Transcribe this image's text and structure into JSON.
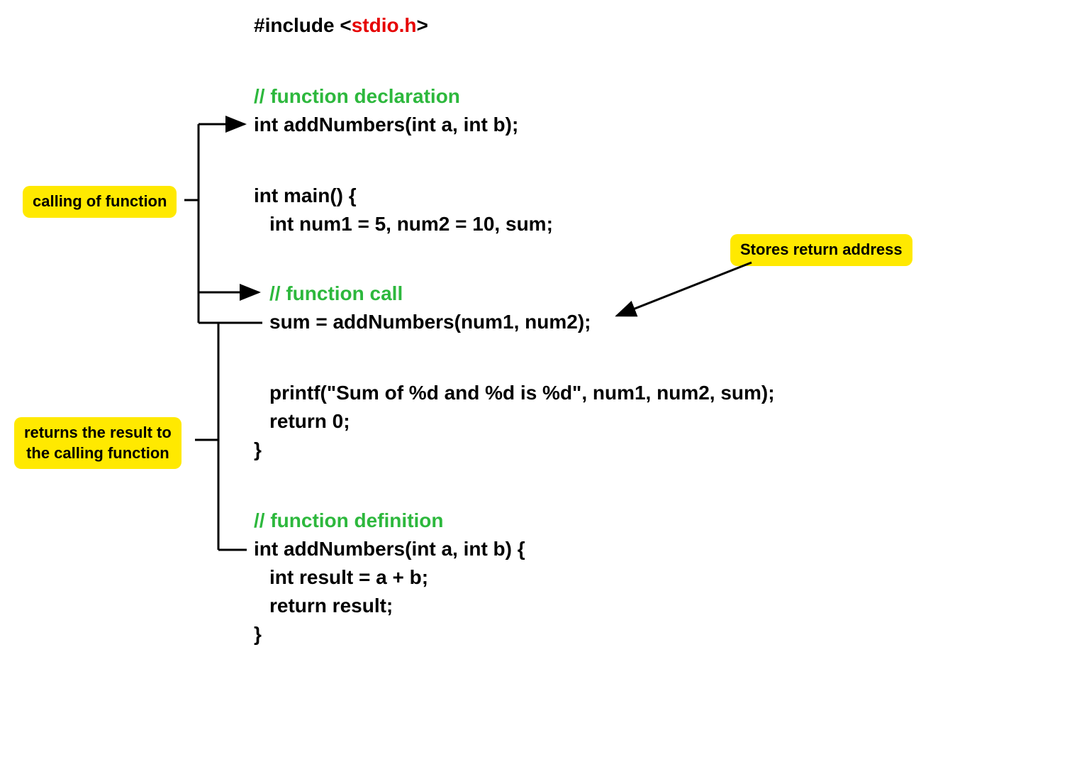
{
  "code": {
    "include_pre": "#include <",
    "include_lib": "stdio.h",
    "include_post": ">",
    "comment_decl": "// function declaration",
    "decl": "int addNumbers(int a, int b);",
    "main_sig": "int main() {",
    "main_vars": "int num1 = 5, num2 = 10, sum;",
    "comment_call": "// function call",
    "call": "sum = addNumbers(num1, num2);",
    "printf": "printf(\"Sum of %d and %d is %d\", num1, num2, sum);",
    "return0": "return 0;",
    "main_close": "}",
    "comment_def": "// function definition",
    "def_sig": "int addNumbers(int a, int b) {",
    "def_body1": "int result = a + b;",
    "def_body2": "return result;",
    "def_close": "}"
  },
  "tags": {
    "calling": "calling of function",
    "returns_l1": "returns the result to",
    "returns_l2": "the calling function",
    "stores": "Stores return address"
  }
}
